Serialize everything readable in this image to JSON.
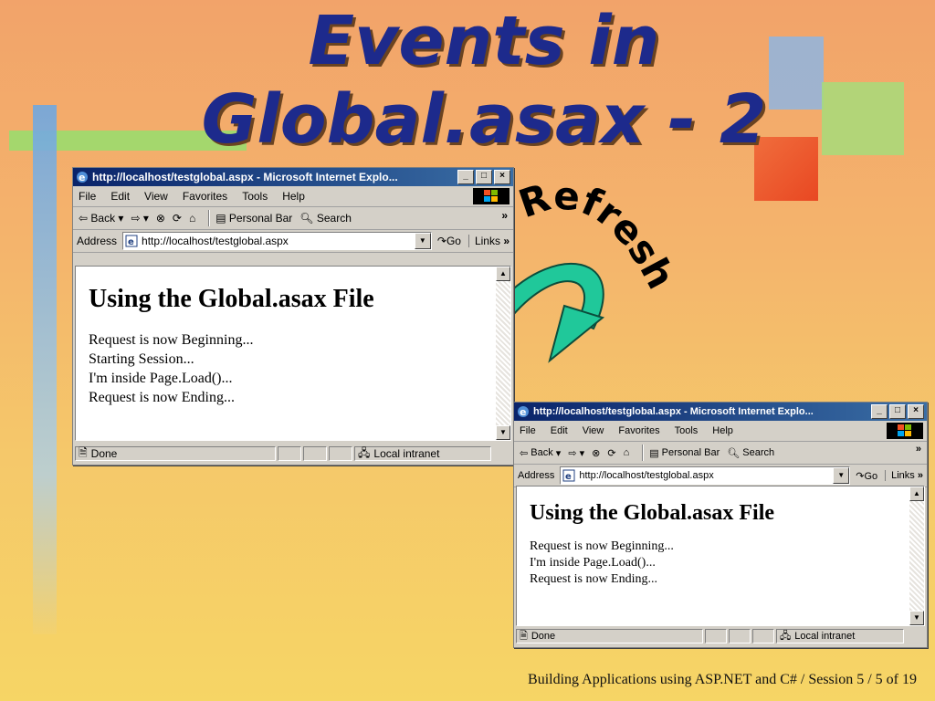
{
  "slide": {
    "title_line1": "Events in",
    "title_line2": "Global.asax - 2",
    "refresh_label": "Refresh",
    "footer": "Building Applications using ASP.NET and C# / Session 5 /  5 of 19",
    "colors": {
      "title": "#1d2a8c",
      "arrow": "#20c89a",
      "bar_blue": "#6fa7e0",
      "bar_green": "#8fd86a"
    }
  },
  "windows": [
    {
      "title": "http://localhost/testglobal.aspx - Microsoft Internet Explo...",
      "menu": [
        "File",
        "Edit",
        "View",
        "Favorites",
        "Tools",
        "Help"
      ],
      "toolbar": {
        "back": "Back",
        "personal_bar": "Personal Bar",
        "search": "Search"
      },
      "address_label": "Address",
      "address": "http://localhost/testglobal.aspx",
      "go": "Go",
      "links": "Links",
      "heading": "Using the Global.asax File",
      "lines": [
        "Request is now Beginning...",
        "Starting Session...",
        "I'm inside Page.Load()...",
        "Request is now Ending..."
      ],
      "status_left": "Done",
      "status_zone": "Local intranet"
    },
    {
      "title": "http://localhost/testglobal.aspx - Microsoft Internet Explo...",
      "menu": [
        "File",
        "Edit",
        "View",
        "Favorites",
        "Tools",
        "Help"
      ],
      "toolbar": {
        "back": "Back",
        "personal_bar": "Personal Bar",
        "search": "Search"
      },
      "address_label": "Address",
      "address": "http://localhost/testglobal.aspx",
      "go": "Go",
      "links": "Links",
      "heading": "Using the Global.asax File",
      "lines": [
        "Request is now Beginning...",
        "I'm inside Page.Load()...",
        "Request is now Ending..."
      ],
      "status_left": "Done",
      "status_zone": "Local intranet"
    }
  ]
}
